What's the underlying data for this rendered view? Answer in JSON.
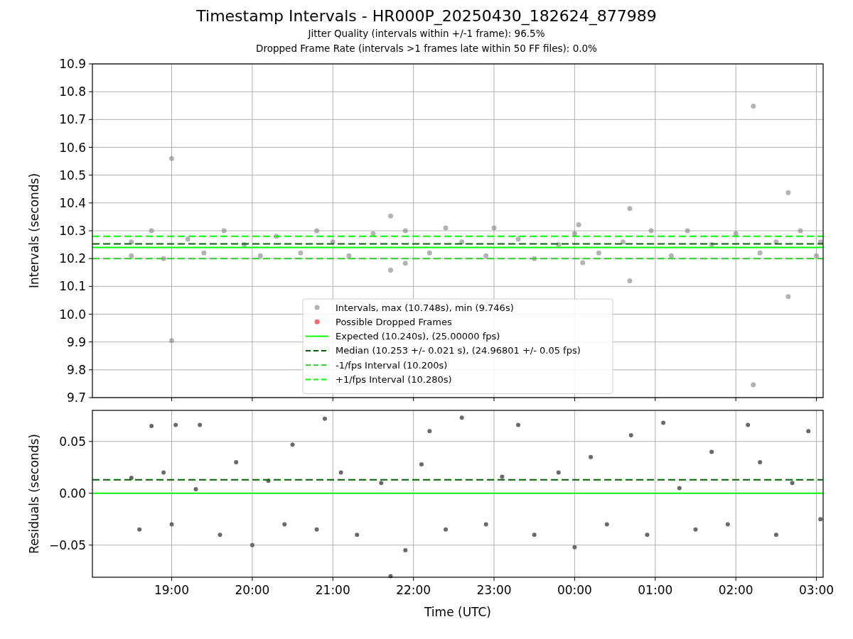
{
  "title": "Timestamp Intervals - HR000P_20250430_182624_877989",
  "subtitles": [
    "Jitter Quality (intervals within +/-1 frame): 96.5%",
    "Dropped Frame Rate (intervals >1 frames late within 50 FF files): 0.0%"
  ],
  "charts": [
    {
      "chart_data": {
        "type": "scatter",
        "ylabel": "Intervals (seconds)",
        "grid": true,
        "legend": true,
        "xlim": [
          "2025-04-30T18:01",
          "2025-05-01T03:05"
        ],
        "ylim": [
          9.7,
          10.9
        ],
        "yticks": [
          {
            "value": 9.7,
            "label": "9.7"
          },
          {
            "value": 9.8,
            "label": "9.8"
          },
          {
            "value": 9.9,
            "label": "9.9"
          },
          {
            "value": 10.0,
            "label": "10.0"
          },
          {
            "value": 10.1,
            "label": "10.1"
          },
          {
            "value": 10.2,
            "label": "10.2"
          },
          {
            "value": 10.3,
            "label": "10.3"
          },
          {
            "value": 10.4,
            "label": "10.4"
          },
          {
            "value": 10.5,
            "label": "10.5"
          },
          {
            "value": 10.6,
            "label": "10.6"
          },
          {
            "value": 10.7,
            "label": "10.7"
          },
          {
            "value": 10.8,
            "label": "10.8"
          },
          {
            "value": 10.9,
            "label": "10.9"
          }
        ],
        "series": [
          {
            "name": "Intervals, max (10.748s), min (9.746s)",
            "color": "#808080",
            "x": [
              "2025-04-30T18:30",
              "2025-04-30T18:30",
              "2025-04-30T18:45",
              "2025-04-30T18:54",
              "2025-04-30T19:00",
              "2025-04-30T19:00",
              "2025-04-30T19:12",
              "2025-04-30T19:24",
              "2025-04-30T19:39",
              "2025-04-30T19:54",
              "2025-04-30T20:06",
              "2025-04-30T20:18",
              "2025-04-30T20:36",
              "2025-04-30T20:48",
              "2025-04-30T21:00",
              "2025-04-30T21:12",
              "2025-04-30T21:30",
              "2025-04-30T21:43",
              "2025-04-30T21:43",
              "2025-04-30T21:54",
              "2025-04-30T21:54",
              "2025-04-30T22:12",
              "2025-04-30T22:24",
              "2025-04-30T22:36",
              "2025-04-30T22:54",
              "2025-04-30T23:00",
              "2025-04-30T23:18",
              "2025-04-30T23:30",
              "2025-04-30T23:48",
              "2025-05-01T00:00",
              "2025-05-01T00:03",
              "2025-05-01T00:06",
              "2025-05-01T00:18",
              "2025-05-01T00:36",
              "2025-05-01T00:41",
              "2025-05-01T00:41",
              "2025-05-01T00:57",
              "2025-05-01T01:12",
              "2025-05-01T01:24",
              "2025-05-01T01:42",
              "2025-05-01T02:00",
              "2025-05-01T02:13",
              "2025-05-01T02:13",
              "2025-05-01T02:18",
              "2025-05-01T02:30",
              "2025-05-01T02:39",
              "2025-05-01T02:39",
              "2025-05-01T02:48",
              "2025-05-01T03:00",
              "2025-05-01T03:03"
            ],
            "values": [
              10.21,
              10.26,
              10.3,
              10.2,
              10.56,
              9.905,
              10.27,
              10.22,
              10.3,
              10.25,
              10.21,
              10.28,
              10.22,
              10.3,
              10.26,
              10.21,
              10.29,
              10.353,
              10.158,
              10.3,
              10.183,
              10.22,
              10.31,
              10.26,
              10.21,
              10.31,
              10.27,
              10.2,
              10.25,
              10.29,
              10.322,
              10.185,
              10.22,
              10.26,
              10.38,
              10.12,
              10.3,
              10.21,
              10.3,
              10.25,
              10.29,
              10.748,
              9.746,
              10.22,
              10.26,
              10.437,
              10.063,
              10.3,
              10.21,
              10.26
            ]
          },
          {
            "name": "Possible Dropped Frames",
            "color": "#ff0000"
          },
          {
            "name": "Expected (10.240s), (25.00000 fps)",
            "type": "line",
            "color": "#00ff00",
            "x": [
              "2025-04-30T18:01",
              "2025-05-01T03:05"
            ],
            "values": [
              10.24,
              10.24
            ]
          },
          {
            "name": "Median (10.253 +/- 0.021 s), (24.96801 +/- 0.05 fps)",
            "type": "line",
            "line_style": "dashed",
            "color": "#006400",
            "x": [
              "2025-04-30T18:01",
              "2025-05-01T03:05"
            ],
            "values": [
              10.253,
              10.253
            ]
          },
          {
            "name": "-1/fps Interval (10.200s)",
            "type": "line",
            "line_style": "dashed",
            "color": "#32cd32",
            "x": [
              "2025-04-30T18:01",
              "2025-05-01T03:05"
            ],
            "values": [
              10.2,
              10.2
            ]
          },
          {
            "name": "+1/fps Interval (10.280s)",
            "type": "line",
            "line_style": "dashed",
            "color": "#00ff00",
            "x": [
              "2025-04-30T18:01",
              "2025-05-01T03:05"
            ],
            "values": [
              10.28,
              10.28
            ]
          }
        ]
      }
    },
    {
      "chart_data": {
        "type": "scatter",
        "xlabel": "Time (UTC)",
        "ylabel": "Residuals (seconds)",
        "grid": true,
        "xlim": [
          "2025-04-30T18:01",
          "2025-05-01T03:05"
        ],
        "ylim": [
          -0.081,
          0.08
        ],
        "yticks": [
          {
            "value": -0.05,
            "label": "−0.05"
          },
          {
            "value": 0,
            "label": "0.00"
          },
          {
            "value": 0.05,
            "label": "0.05"
          }
        ],
        "xticks": [
          {
            "value": "2025-04-30T19:00",
            "label": "19:00"
          },
          {
            "value": "2025-04-30T20:00",
            "label": "20:00"
          },
          {
            "value": "2025-04-30T21:00",
            "label": "21:00"
          },
          {
            "value": "2025-04-30T22:00",
            "label": "22:00"
          },
          {
            "value": "2025-04-30T23:00",
            "label": "23:00"
          },
          {
            "value": "2025-05-01T00:00",
            "label": "00:00"
          },
          {
            "value": "2025-05-01T01:00",
            "label": "01:00"
          },
          {
            "value": "2025-05-01T02:00",
            "label": "02:00"
          },
          {
            "value": "2025-05-01T03:00",
            "label": "03:00"
          }
        ],
        "series": [
          {
            "color": "#696969",
            "x": [
              "2025-04-30T18:30",
              "2025-04-30T18:36",
              "2025-04-30T18:45",
              "2025-04-30T18:54",
              "2025-04-30T19:00",
              "2025-04-30T19:03",
              "2025-04-30T19:18",
              "2025-04-30T19:21",
              "2025-04-30T19:36",
              "2025-04-30T19:48",
              "2025-04-30T20:00",
              "2025-04-30T20:12",
              "2025-04-30T20:24",
              "2025-04-30T20:30",
              "2025-04-30T20:48",
              "2025-04-30T20:54",
              "2025-04-30T21:06",
              "2025-04-30T21:18",
              "2025-04-30T21:36",
              "2025-04-30T21:43",
              "2025-04-30T21:54",
              "2025-04-30T22:06",
              "2025-04-30T22:12",
              "2025-04-30T22:24",
              "2025-04-30T22:36",
              "2025-04-30T22:54",
              "2025-04-30T23:06",
              "2025-04-30T23:18",
              "2025-04-30T23:30",
              "2025-04-30T23:48",
              "2025-05-01T00:00",
              "2025-05-01T00:12",
              "2025-05-01T00:24",
              "2025-05-01T00:42",
              "2025-05-01T00:54",
              "2025-05-01T01:06",
              "2025-05-01T01:18",
              "2025-05-01T01:30",
              "2025-05-01T01:42",
              "2025-05-01T01:54",
              "2025-05-01T02:09",
              "2025-05-01T02:18",
              "2025-05-01T02:30",
              "2025-05-01T02:42",
              "2025-05-01T02:54",
              "2025-05-01T03:03"
            ],
            "values": [
              0.015,
              -0.035,
              0.065,
              0.02,
              -0.03,
              0.066,
              0.004,
              0.066,
              -0.04,
              0.03,
              -0.05,
              0.012,
              -0.03,
              0.047,
              -0.035,
              0.072,
              0.02,
              -0.04,
              0.01,
              -0.08,
              -0.055,
              0.028,
              0.06,
              -0.035,
              0.073,
              -0.03,
              0.016,
              0.066,
              -0.04,
              0.02,
              -0.052,
              0.035,
              -0.03,
              0.056,
              -0.04,
              0.068,
              0.005,
              -0.035,
              0.04,
              -0.03,
              0.066,
              0.03,
              -0.04,
              0.01,
              0.06,
              -0.025
            ]
          },
          {
            "type": "line",
            "color": "#00ff00",
            "x": [
              "2025-04-30T18:01",
              "2025-05-01T03:05"
            ],
            "values": [
              0,
              0
            ]
          },
          {
            "type": "line",
            "line_style": "dashed",
            "color": "#006400",
            "x": [
              "2025-04-30T18:01",
              "2025-05-01T03:05"
            ],
            "values": [
              0.013,
              0.013
            ]
          }
        ]
      }
    }
  ]
}
